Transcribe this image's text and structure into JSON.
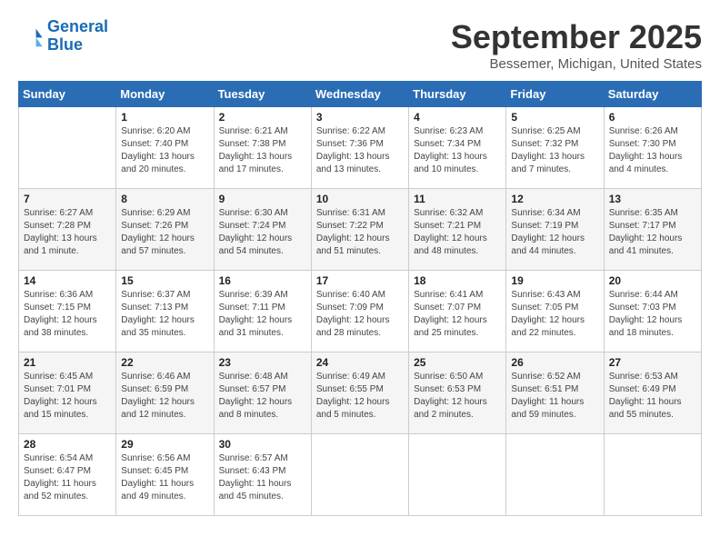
{
  "logo": {
    "name": "General",
    "name2": "Blue"
  },
  "title": "September 2025",
  "subtitle": "Bessemer, Michigan, United States",
  "weekdays": [
    "Sunday",
    "Monday",
    "Tuesday",
    "Wednesday",
    "Thursday",
    "Friday",
    "Saturday"
  ],
  "weeks": [
    [
      {
        "day": "",
        "info": ""
      },
      {
        "day": "1",
        "info": "Sunrise: 6:20 AM\nSunset: 7:40 PM\nDaylight: 13 hours\nand 20 minutes."
      },
      {
        "day": "2",
        "info": "Sunrise: 6:21 AM\nSunset: 7:38 PM\nDaylight: 13 hours\nand 17 minutes."
      },
      {
        "day": "3",
        "info": "Sunrise: 6:22 AM\nSunset: 7:36 PM\nDaylight: 13 hours\nand 13 minutes."
      },
      {
        "day": "4",
        "info": "Sunrise: 6:23 AM\nSunset: 7:34 PM\nDaylight: 13 hours\nand 10 minutes."
      },
      {
        "day": "5",
        "info": "Sunrise: 6:25 AM\nSunset: 7:32 PM\nDaylight: 13 hours\nand 7 minutes."
      },
      {
        "day": "6",
        "info": "Sunrise: 6:26 AM\nSunset: 7:30 PM\nDaylight: 13 hours\nand 4 minutes."
      }
    ],
    [
      {
        "day": "7",
        "info": "Sunrise: 6:27 AM\nSunset: 7:28 PM\nDaylight: 13 hours\nand 1 minute."
      },
      {
        "day": "8",
        "info": "Sunrise: 6:29 AM\nSunset: 7:26 PM\nDaylight: 12 hours\nand 57 minutes."
      },
      {
        "day": "9",
        "info": "Sunrise: 6:30 AM\nSunset: 7:24 PM\nDaylight: 12 hours\nand 54 minutes."
      },
      {
        "day": "10",
        "info": "Sunrise: 6:31 AM\nSunset: 7:22 PM\nDaylight: 12 hours\nand 51 minutes."
      },
      {
        "day": "11",
        "info": "Sunrise: 6:32 AM\nSunset: 7:21 PM\nDaylight: 12 hours\nand 48 minutes."
      },
      {
        "day": "12",
        "info": "Sunrise: 6:34 AM\nSunset: 7:19 PM\nDaylight: 12 hours\nand 44 minutes."
      },
      {
        "day": "13",
        "info": "Sunrise: 6:35 AM\nSunset: 7:17 PM\nDaylight: 12 hours\nand 41 minutes."
      }
    ],
    [
      {
        "day": "14",
        "info": "Sunrise: 6:36 AM\nSunset: 7:15 PM\nDaylight: 12 hours\nand 38 minutes."
      },
      {
        "day": "15",
        "info": "Sunrise: 6:37 AM\nSunset: 7:13 PM\nDaylight: 12 hours\nand 35 minutes."
      },
      {
        "day": "16",
        "info": "Sunrise: 6:39 AM\nSunset: 7:11 PM\nDaylight: 12 hours\nand 31 minutes."
      },
      {
        "day": "17",
        "info": "Sunrise: 6:40 AM\nSunset: 7:09 PM\nDaylight: 12 hours\nand 28 minutes."
      },
      {
        "day": "18",
        "info": "Sunrise: 6:41 AM\nSunset: 7:07 PM\nDaylight: 12 hours\nand 25 minutes."
      },
      {
        "day": "19",
        "info": "Sunrise: 6:43 AM\nSunset: 7:05 PM\nDaylight: 12 hours\nand 22 minutes."
      },
      {
        "day": "20",
        "info": "Sunrise: 6:44 AM\nSunset: 7:03 PM\nDaylight: 12 hours\nand 18 minutes."
      }
    ],
    [
      {
        "day": "21",
        "info": "Sunrise: 6:45 AM\nSunset: 7:01 PM\nDaylight: 12 hours\nand 15 minutes."
      },
      {
        "day": "22",
        "info": "Sunrise: 6:46 AM\nSunset: 6:59 PM\nDaylight: 12 hours\nand 12 minutes."
      },
      {
        "day": "23",
        "info": "Sunrise: 6:48 AM\nSunset: 6:57 PM\nDaylight: 12 hours\nand 8 minutes."
      },
      {
        "day": "24",
        "info": "Sunrise: 6:49 AM\nSunset: 6:55 PM\nDaylight: 12 hours\nand 5 minutes."
      },
      {
        "day": "25",
        "info": "Sunrise: 6:50 AM\nSunset: 6:53 PM\nDaylight: 12 hours\nand 2 minutes."
      },
      {
        "day": "26",
        "info": "Sunrise: 6:52 AM\nSunset: 6:51 PM\nDaylight: 11 hours\nand 59 minutes."
      },
      {
        "day": "27",
        "info": "Sunrise: 6:53 AM\nSunset: 6:49 PM\nDaylight: 11 hours\nand 55 minutes."
      }
    ],
    [
      {
        "day": "28",
        "info": "Sunrise: 6:54 AM\nSunset: 6:47 PM\nDaylight: 11 hours\nand 52 minutes."
      },
      {
        "day": "29",
        "info": "Sunrise: 6:56 AM\nSunset: 6:45 PM\nDaylight: 11 hours\nand 49 minutes."
      },
      {
        "day": "30",
        "info": "Sunrise: 6:57 AM\nSunset: 6:43 PM\nDaylight: 11 hours\nand 45 minutes."
      },
      {
        "day": "",
        "info": ""
      },
      {
        "day": "",
        "info": ""
      },
      {
        "day": "",
        "info": ""
      },
      {
        "day": "",
        "info": ""
      }
    ]
  ]
}
